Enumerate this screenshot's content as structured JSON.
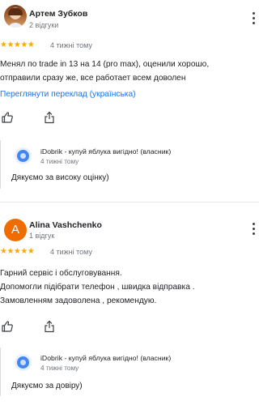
{
  "colors": {
    "star": "#f9ab00",
    "link": "#1a73e8",
    "avatar_letter_bg": "#ef6c00",
    "secondary_text": "#70757a"
  },
  "reviews": [
    {
      "author": "Артем Зубков",
      "reviews_count": "2 відгуки",
      "stars": "★★★★★",
      "rating": 5,
      "date": "4 тижні тому",
      "text": "Менял по trade in 13 на 14 (pro max), оценили хорошо,\nотправили сразу же, все работает всем доволен",
      "translate_link": "Переглянути переклад (українська)",
      "reply": {
        "owner": "iDobrik - купуй яблука вигідно! (власник)",
        "date": "4 тижні тому",
        "text": "Дякуємо за високу оцінку)"
      }
    },
    {
      "author": "Alina Vashchenko",
      "avatar_letter": "A",
      "reviews_count": "1 відгук",
      "stars": "★★★★★",
      "rating": 5,
      "date": "4 тижні тому",
      "text": "Гарний сервіс і обслуговування.\nДопомогли підібрати телефон , швидка відправка .\nЗамовленням задоволена , рекомендую.",
      "reply": {
        "owner": "iDobrik - купуй яблука вигідно! (власник)",
        "date": "4 тижні тому",
        "text": "Дякуємо за довіру)"
      }
    }
  ]
}
